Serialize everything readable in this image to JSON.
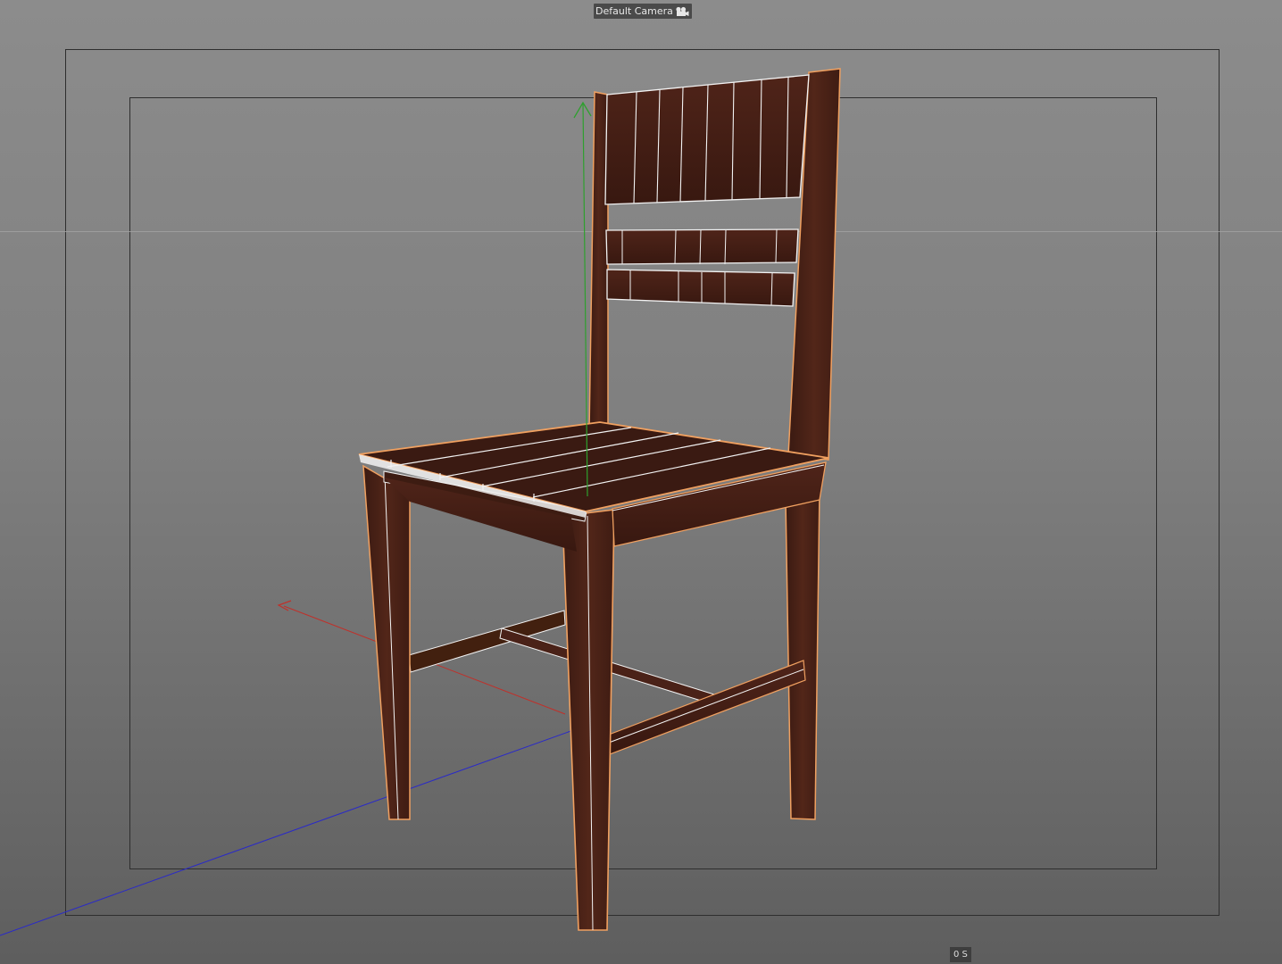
{
  "viewport": {
    "camera_label": "Default Camera",
    "camera_icon": "camera-icon",
    "time_label": "0 S"
  },
  "scene": {
    "object": "chair",
    "selected": true,
    "colors": {
      "wood": "#4a2218",
      "wood_dark": "#3a1a12",
      "wood_light": "#5a2c1e",
      "wireframe": "#f2f2f2",
      "selection_outline": "#f0a060",
      "axis_x": "#c0302a",
      "axis_y": "#2ea02e",
      "axis_z": "#2a2ac8"
    }
  }
}
